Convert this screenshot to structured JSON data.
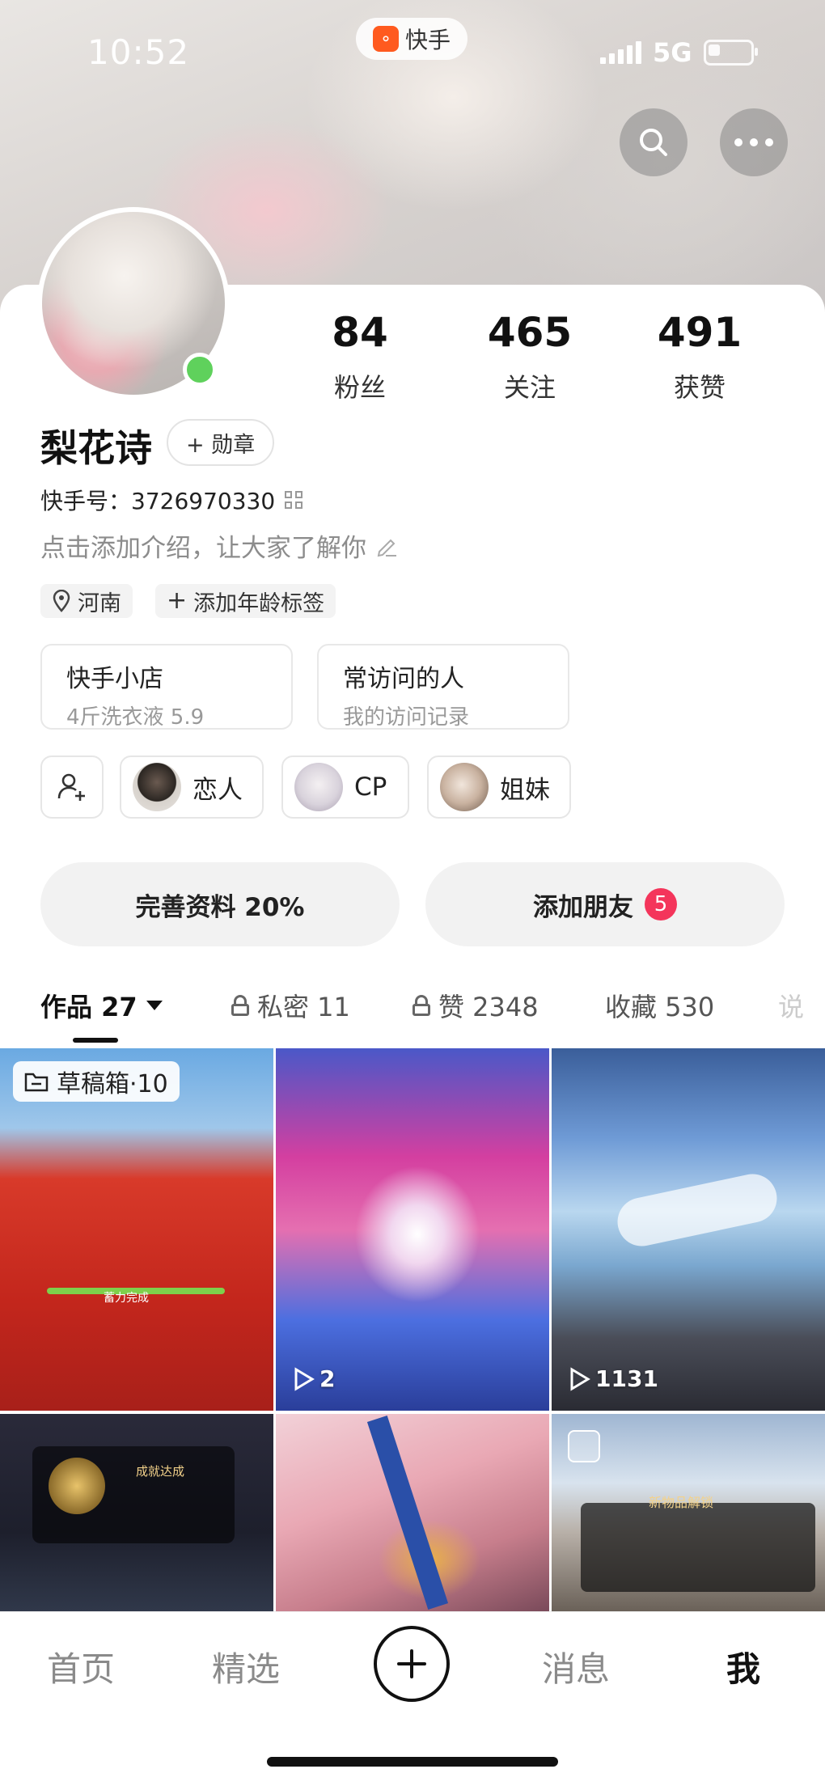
{
  "status_bar": {
    "time": "10:52",
    "network": "5G"
  },
  "app_badge": {
    "label": "快手",
    "logo_icon": "kuaishou-logo"
  },
  "header": {
    "search_icon": "search-icon",
    "more_icon": "more-dots-icon"
  },
  "profile": {
    "stats": [
      {
        "value": "84",
        "label": "粉丝"
      },
      {
        "value": "465",
        "label": "关注"
      },
      {
        "value": "491",
        "label": "获赞"
      }
    ],
    "username": "梨花诗",
    "medal_label": "+ 勋章",
    "kuaishou_id": "快手号：3726970330",
    "intro_placeholder": "点击添加介绍，让大家了解你",
    "tags": [
      {
        "icon": "location-icon",
        "label": "河南"
      },
      {
        "icon": "plus-icon",
        "label": "添加年龄标签"
      }
    ]
  },
  "cards": [
    {
      "title": "快手小店",
      "subtitle": "4斤洗衣液 5.9"
    },
    {
      "title": "常访问的人",
      "subtitle": "我的访问记录"
    }
  ],
  "relations": [
    {
      "label": "恋人"
    },
    {
      "label": "CP"
    },
    {
      "label": "姐妹"
    }
  ],
  "actions": {
    "complete_profile": "完善资料 20%",
    "add_friends": "添加朋友",
    "add_friends_badge": "5"
  },
  "tabs": [
    {
      "label": "作品 27",
      "active": true
    },
    {
      "label": "私密 11",
      "locked": true
    },
    {
      "label": "赞 2348",
      "locked": true
    },
    {
      "label": "收藏 530"
    },
    {
      "label": "说"
    }
  ],
  "grid": {
    "draft_label": "草稿箱·10",
    "items": [
      {
        "caption": "蓄力完成",
        "plays": ""
      },
      {
        "caption": "",
        "plays": "2"
      },
      {
        "caption": "",
        "plays": "1131"
      },
      {
        "caption": "成就达成",
        "plays": ""
      },
      {
        "caption": "",
        "plays": ""
      },
      {
        "caption": "新物品解锁",
        "plays": ""
      }
    ]
  },
  "bottom_nav": {
    "items": [
      "首页",
      "精选",
      "消息",
      "我"
    ],
    "active": "我"
  }
}
